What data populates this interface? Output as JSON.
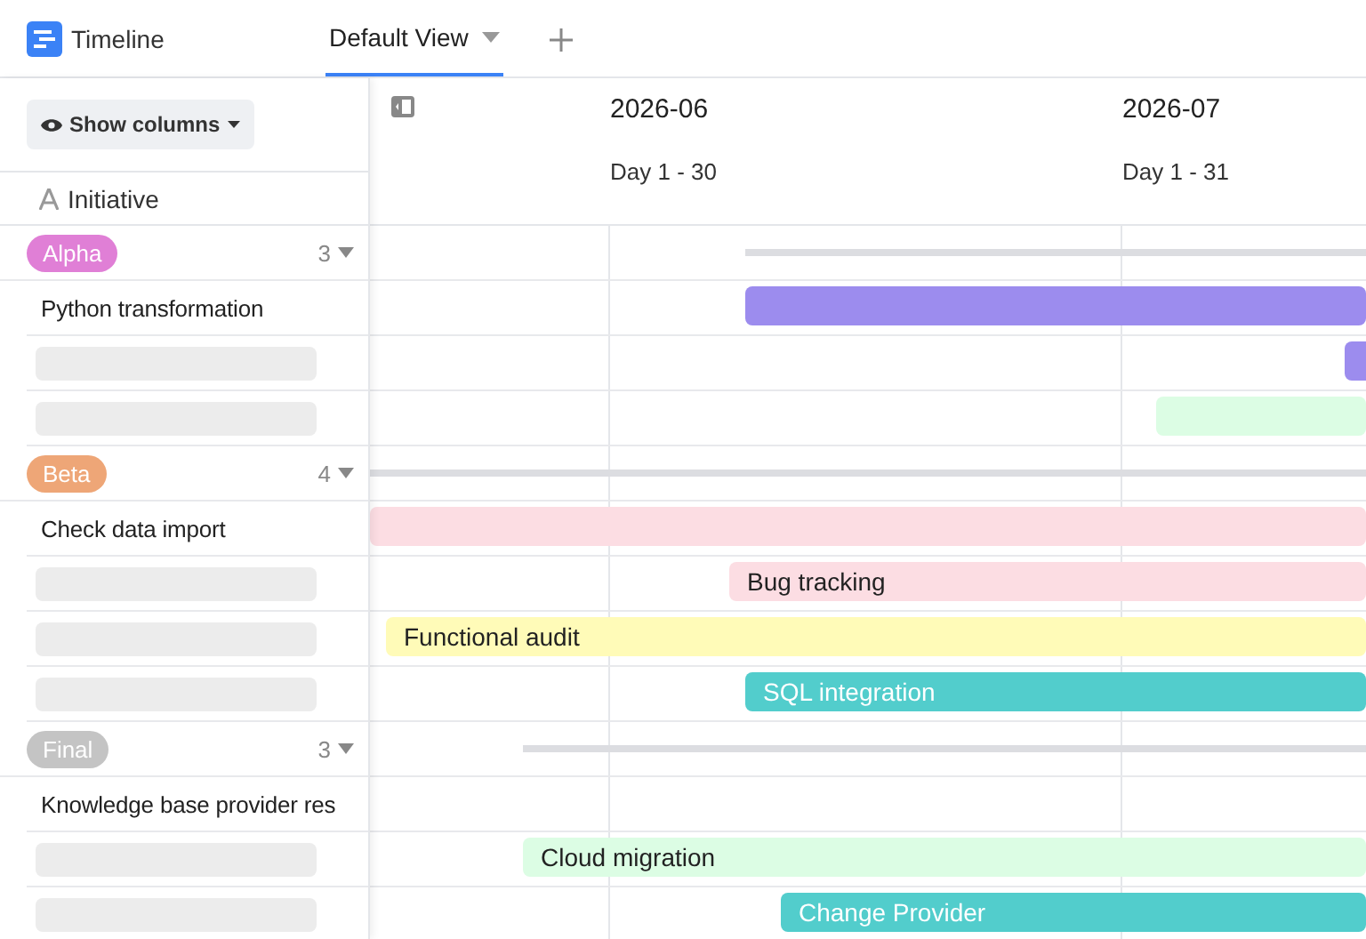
{
  "app": {
    "title": "Timeline"
  },
  "tabs": [
    {
      "label": "Default View",
      "selected": true
    }
  ],
  "toolbar": {
    "show_columns": "Show columns"
  },
  "column_header": {
    "label": "Initiative"
  },
  "months": [
    {
      "label": "2026-06",
      "days": "Day 1 - 30"
    },
    {
      "label": "2026-07",
      "days": "Day 1 - 31"
    }
  ],
  "groups": [
    {
      "tag": "Alpha",
      "color": "#e07fd6",
      "count": "3",
      "expanded": true,
      "items": [
        {
          "kind": "text",
          "title": "Python transformation",
          "bar": {
            "color": "#9c8cee"
          }
        },
        {
          "kind": "placeholder",
          "bar": {
            "color": "#9c8cee"
          }
        },
        {
          "kind": "placeholder",
          "bar": {
            "color": "#dcfde4"
          }
        }
      ]
    },
    {
      "tag": "Beta",
      "color": "#eea677",
      "count": "4",
      "expanded": true,
      "items": [
        {
          "kind": "text",
          "title": "Check data import",
          "bar": {
            "color": "#fcdde3"
          }
        },
        {
          "kind": "placeholder",
          "bar": {
            "color": "#fcdde3",
            "label": "Bug tracking"
          }
        },
        {
          "kind": "placeholder",
          "bar": {
            "color": "#fffbb8",
            "label": "Functional audit"
          }
        },
        {
          "kind": "placeholder",
          "bar": {
            "color": "#52cdcc",
            "label": "SQL integration"
          }
        }
      ]
    },
    {
      "tag": "Final",
      "color": "#c4c4c4",
      "count": "3",
      "expanded": true,
      "items": [
        {
          "kind": "text",
          "title": "Knowledge base provider res"
        },
        {
          "kind": "placeholder",
          "bar": {
            "color": "#dcfde4",
            "label": "Cloud migration"
          }
        },
        {
          "kind": "placeholder",
          "bar": {
            "color": "#52cdcc",
            "label": "Change Provider"
          }
        }
      ]
    }
  ]
}
